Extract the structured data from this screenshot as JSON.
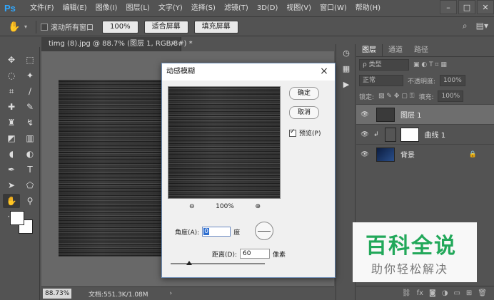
{
  "app": {
    "logo": "Ps",
    "menu": [
      "文件(F)",
      "编辑(E)",
      "图像(I)",
      "图层(L)",
      "文字(Y)",
      "选择(S)",
      "滤镜(T)",
      "3D(D)",
      "视图(V)",
      "窗口(W)",
      "帮助(H)"
    ],
    "window_controls": [
      "minimize-icon",
      "maximize-icon",
      "close-icon"
    ]
  },
  "options_bar": {
    "scroll_all_label": "滚动所有窗口",
    "zoom_btn": "100%",
    "fit_screen_btn": "适合屏幕",
    "fill_screen_btn": "填充屏幕"
  },
  "document": {
    "tab_title": "timg (8).jpg @ 88.7% (图层 1, RGB/8#) *",
    "tab_close": "×",
    "zoom": "88.73%",
    "doc_info": "文档:551.3K/1.08M",
    "info_arrow": "›"
  },
  "dialog": {
    "title": "动感模糊",
    "close": "×",
    "ok": "确定",
    "cancel": "取消",
    "preview_label": "预览(P)",
    "preview_checked": true,
    "zoom_out": "⊖",
    "zoom_level": "100%",
    "zoom_in": "⊕",
    "angle_label": "角度(A):",
    "angle_value": "0",
    "angle_unit": "度",
    "distance_label": "距离(D):",
    "distance_value": "60",
    "distance_unit": "像素",
    "distance_slider_fraction": 0.2
  },
  "layers_panel": {
    "tabs": [
      "图层",
      "通道",
      "路径"
    ],
    "filter_placeholder": "ρ 类型",
    "blend_mode": "正常",
    "opacity_label": "不透明度:",
    "opacity_value": "100%",
    "lock_label": "锁定:",
    "fill_label": "填充:",
    "fill_value": "100%",
    "layers": [
      {
        "name": "图层 1",
        "selected": true
      },
      {
        "name": "曲线 1",
        "selected": false
      },
      {
        "name": "背景",
        "selected": false,
        "locked": true
      }
    ]
  },
  "watermark": {
    "title": "百科全说",
    "subtitle": "助你轻松解决"
  }
}
